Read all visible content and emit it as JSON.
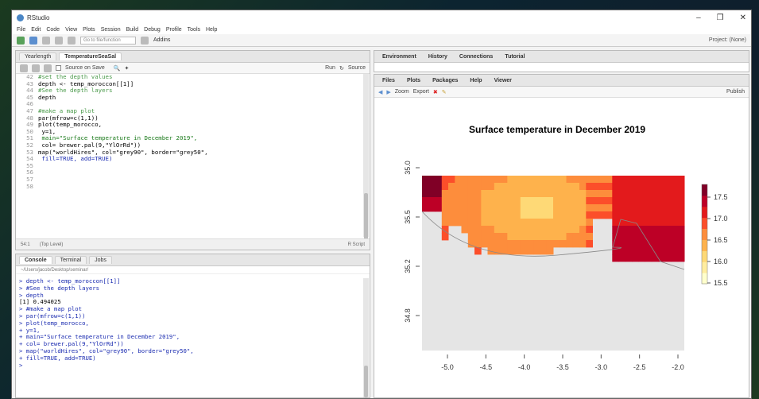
{
  "window": {
    "title": "RStudio",
    "controls": [
      "–",
      "❐",
      "✕"
    ]
  },
  "menu": [
    "File",
    "Edit",
    "Code",
    "View",
    "Plots",
    "Session",
    "Build",
    "Debug",
    "Profile",
    "Tools",
    "Help"
  ],
  "toolbar": {
    "goto_placeholder": "Go to file/function",
    "addins": "Addins",
    "project": "Project: (None)"
  },
  "editor": {
    "tabs": [
      "Yearlength",
      "TemperatureSeaSal"
    ],
    "source_on_save": "Source on Save",
    "run": "Run",
    "source": "Source",
    "lines": [
      {
        "n": "42",
        "t": "#set the depth values"
      },
      {
        "n": "43",
        "t": "depth <- temp_moroccon[[1]]"
      },
      {
        "n": "44",
        "t": "#See the depth layers"
      },
      {
        "n": "45",
        "t": "depth"
      },
      {
        "n": "46",
        "t": ""
      },
      {
        "n": "47",
        "t": "#make a map plot"
      },
      {
        "n": "48",
        "t": "par(mfrow=c(1,1))"
      },
      {
        "n": "49",
        "t": "plot(temp_morocco,"
      },
      {
        "n": "50",
        "t": "     y=1,"
      },
      {
        "n": "51",
        "t": "     main=\"Surface temperature in December 2019\","
      },
      {
        "n": "52",
        "t": "     col= brewer.pal(9,\"YlOrRd\"))"
      },
      {
        "n": "53",
        "t": "map(\"worldHires\", col=\"grey90\", border=\"grey50\","
      },
      {
        "n": "54",
        "t": "    fill=TRUE, add=TRUE)"
      },
      {
        "n": "55",
        "t": ""
      },
      {
        "n": "56",
        "t": ""
      },
      {
        "n": "57",
        "t": ""
      },
      {
        "n": "58",
        "t": ""
      }
    ],
    "status_pos": "54:1",
    "status_scope": "(Top Level)",
    "status_type": "R Script"
  },
  "console": {
    "tabs": [
      "Console",
      "Terminal",
      "Jobs"
    ],
    "path": "~/Users/jacob/Desktop/seminar/",
    "lines": [
      {
        "k": "in",
        "t": "> depth <- temp_moroccon[[1]]"
      },
      {
        "k": "in",
        "t": "> #See the depth layers"
      },
      {
        "k": "in",
        "t": "> depth"
      },
      {
        "k": "out",
        "t": "[1] 0.494025"
      },
      {
        "k": "in",
        "t": "> #make a map plot"
      },
      {
        "k": "in",
        "t": "> par(mfrow=c(1,1))"
      },
      {
        "k": "in",
        "t": "> plot(temp_morocco,"
      },
      {
        "k": "in",
        "t": "+      y=1,"
      },
      {
        "k": "in",
        "t": "+      main=\"Surface temperature in December 2019\","
      },
      {
        "k": "in",
        "t": "+      col= brewer.pal(9,\"YlOrRd\"))"
      },
      {
        "k": "in",
        "t": "> map(\"worldHires\", col=\"grey90\", border=\"grey50\","
      },
      {
        "k": "in",
        "t": "+     fill=TRUE, add=TRUE)"
      },
      {
        "k": "in",
        "t": "> "
      }
    ]
  },
  "env_pane": {
    "tabs": [
      "Environment",
      "History",
      "Connections",
      "Tutorial"
    ]
  },
  "files_pane": {
    "tabs": [
      "Files",
      "Plots",
      "Packages",
      "Help",
      "Viewer"
    ],
    "zoom": "Zoom",
    "export": "Export",
    "publish": "Publish"
  },
  "plot": {
    "title": "Surface temperature in December 2019",
    "x_ticks": [
      "-5.0",
      "-4.5",
      "-4.0",
      "-3.5",
      "-3.0",
      "-2.5",
      "-2.0"
    ],
    "y_ticks": [
      "35.0",
      "35.5",
      "35.2",
      "34.8"
    ],
    "legend": [
      "17.5",
      "17.0",
      "16.5",
      "16.0",
      "15.5"
    ],
    "palette": [
      "#FFFFCC",
      "#FFEDA0",
      "#FED976",
      "#FEB24C",
      "#FD8D3C",
      "#FC4E2A",
      "#E31A1C",
      "#BD0026",
      "#800026"
    ],
    "land_color": "#e5e5e5"
  }
}
